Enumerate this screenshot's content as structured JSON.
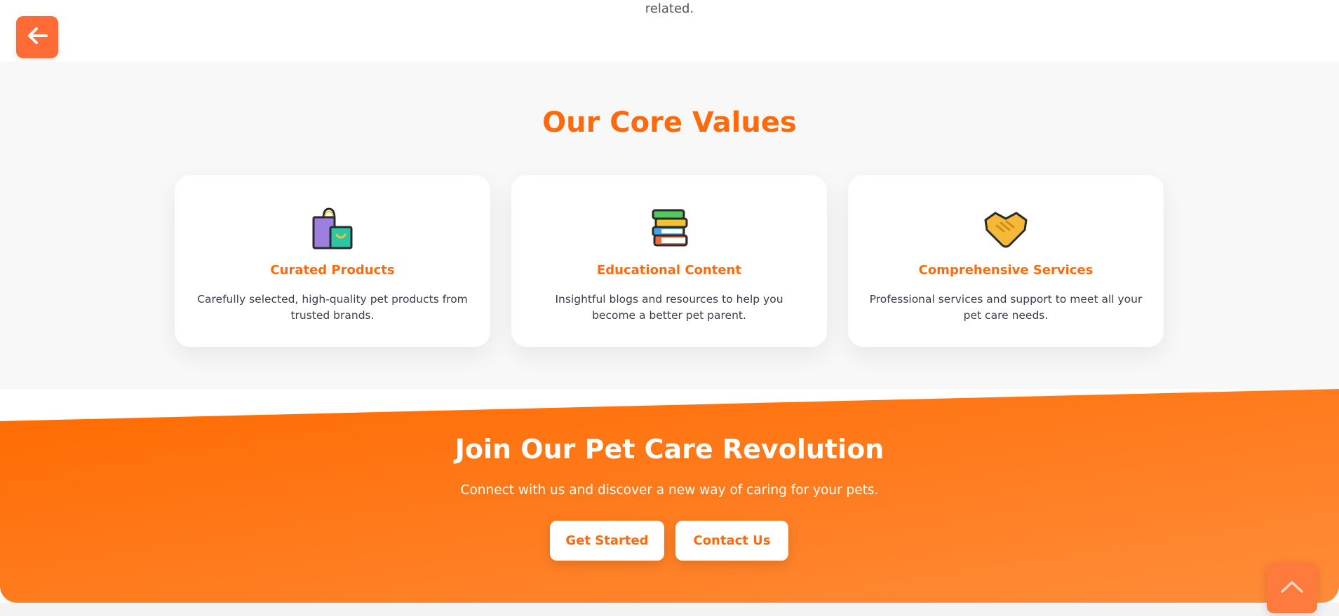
{
  "top": {
    "text": "related.",
    "back_icon": "arrow-left-icon"
  },
  "values": {
    "title": "Our Core Values",
    "cards": [
      {
        "icon": "shopping-bags-icon",
        "title": "Curated Products",
        "description": "Carefully selected, high-quality pet products from trusted brands."
      },
      {
        "icon": "books-icon",
        "title": "Educational Content",
        "description": "Insightful blogs and resources to help you become a better pet parent."
      },
      {
        "icon": "handshake-icon",
        "title": "Comprehensive Services",
        "description": "Professional services and support to meet all your pet care needs."
      }
    ]
  },
  "cta": {
    "title": "Join Our Pet Care Revolution",
    "subtitle": "Connect with us and discover a new way of caring for your pets.",
    "primary_label": "Get Started",
    "secondary_label": "Contact Us"
  },
  "scroll_top": {
    "icon": "chevron-up-icon"
  },
  "colors": {
    "accent": "#ff6a0d",
    "button": "#ff6b35",
    "section_bg": "#f8f8f8"
  }
}
